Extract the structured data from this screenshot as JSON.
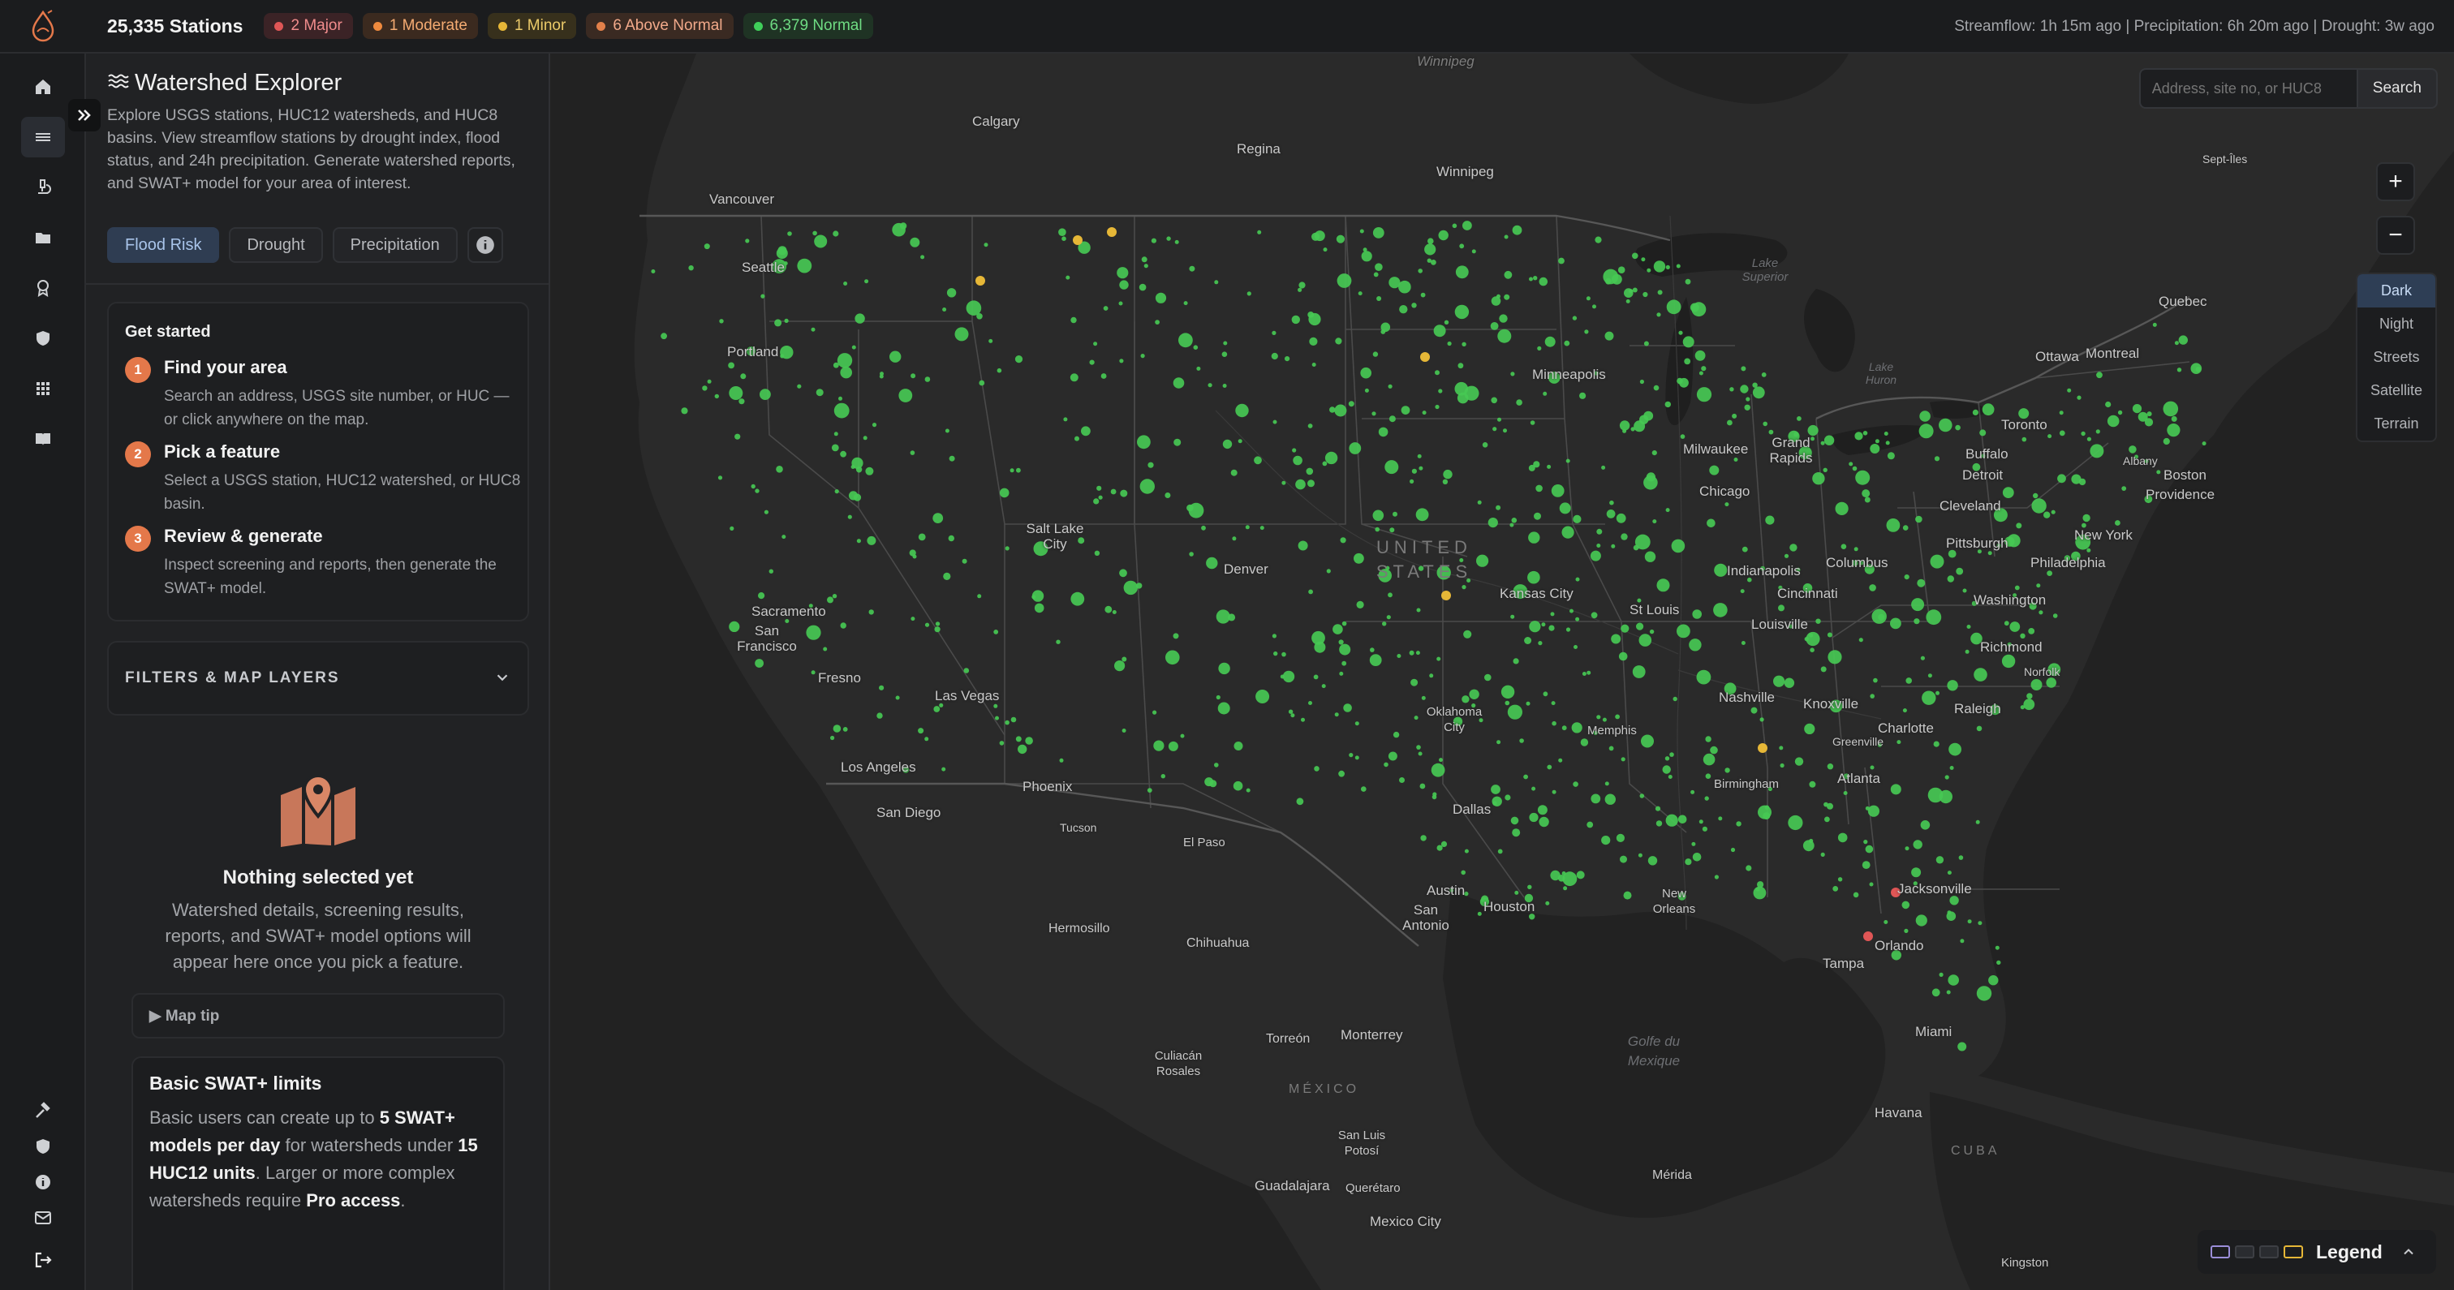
{
  "topbar": {
    "stations": "25,335 Stations",
    "badges": [
      {
        "label": "2 Major",
        "color": "#e05656",
        "bg": "#3b2326",
        "text": "#f08c8c"
      },
      {
        "label": "1 Moderate",
        "color": "#ef8a3e",
        "bg": "#3b2a1f",
        "text": "#f4ab72"
      },
      {
        "label": "1 Minor",
        "color": "#e6b737",
        "bg": "#37301c",
        "text": "#eccb6a"
      },
      {
        "label": "6 Above Normal",
        "color": "#e3804a",
        "bg": "#3a2a22",
        "text": "#f1a98a"
      },
      {
        "label": "6,379 Normal",
        "color": "#3fcf5a",
        "bg": "#1f3324",
        "text": "#6fdc83"
      }
    ],
    "status": "Streamflow: 1h 15m ago | Precipitation: 6h 20m ago | Drought: 3w ago"
  },
  "rail": {
    "top_icons": [
      "home-icon",
      "layers-icon",
      "microscope-icon",
      "folder-icon",
      "award-icon",
      "shield-check-icon",
      "grid-icon",
      "book-icon"
    ],
    "bottom_icons": [
      "hammer-icon",
      "shield-icon",
      "info-icon",
      "mail-icon",
      "logout-icon"
    ]
  },
  "panel": {
    "title": "Watershed Explorer",
    "description": "Explore USGS stations, HUC12 watersheds, and HUC8 basins. View streamflow stations by drought index, flood status, and 24h precipitation. Generate watershed reports, and SWAT+ model for your area of interest.",
    "tabs": [
      "Flood Risk",
      "Drought",
      "Precipitation"
    ],
    "get_started": {
      "title": "Get started",
      "steps": [
        {
          "num": "1",
          "title": "Find your area",
          "desc": "Search an address, USGS site number, or HUC — or click anywhere on the map."
        },
        {
          "num": "2",
          "title": "Pick a feature",
          "desc": "Select a USGS station, HUC12 watershed, or HUC8 basin."
        },
        {
          "num": "3",
          "title": "Review & generate",
          "desc": "Inspect screening and reports, then generate the SWAT+ model."
        }
      ]
    },
    "filters_label": "FILTERS & MAP LAYERS",
    "empty": {
      "title": "Nothing selected yet",
      "desc": "Watershed details, screening results, reports, and SWAT+ model options will appear here once you pick a feature."
    },
    "map_tip": "▶ Map tip",
    "limits": {
      "title": "Basic SWAT+ limits",
      "p1": "Basic users can create up to ",
      "b1": "5 SWAT+ models per day",
      "p2": " for watersheds under ",
      "b2": "15 HUC12 units",
      "p3": ". Larger or more complex watersheds require ",
      "b3": "Pro access",
      "p4": "."
    }
  },
  "map": {
    "search_placeholder": "Address, site no, or HUC8",
    "search_label": "Search",
    "zoom_in": "+",
    "zoom_out": "−",
    "styles": [
      "Dark",
      "Night",
      "Streets",
      "Satellite",
      "Terrain"
    ],
    "active_style": "Dark",
    "legend_label": "Legend",
    "cities": [
      "Winnipeg",
      "Calgary",
      "Regina",
      "Winnipeg",
      "Vancouver",
      "Seattle",
      "Portland",
      "Minneapolis",
      "Milwaukee",
      "Grand Rapids",
      "Detroit",
      "Toronto",
      "Ottawa",
      "Montreal",
      "Quebec",
      "Buffalo",
      "Albany",
      "Boston",
      "Providence",
      "Cleveland",
      "Chicago",
      "Pittsburgh",
      "New York",
      "Philadelphia",
      "Washington",
      "Richmond",
      "Norfolk",
      "Raleigh",
      "Charlotte",
      "Greenville",
      "Knoxville",
      "Nashville",
      "Louisville",
      "Cincinnati",
      "Columbus",
      "Indianapolis",
      "St Louis",
      "Kansas City",
      "Denver",
      "Salt Lake City",
      "Sacramento",
      "San Francisco",
      "Fresno",
      "Las Vegas",
      "Los Angeles",
      "San Diego",
      "Phoenix",
      "Tucson",
      "El Paso",
      "Oklahoma City",
      "Dallas",
      "Memphis",
      "Birmingham",
      "Atlanta",
      "Jacksonville",
      "Orlando",
      "Tampa",
      "Miami",
      "New Orleans",
      "Houston",
      "Austin",
      "San Antonio",
      "Hermosillo",
      "Chihuahua",
      "Torreón",
      "Monterrey",
      "Culiacán Rosales",
      "San Luis Potosí",
      "Guadalajara",
      "Querétaro",
      "Mexico City",
      "Mérida",
      "Havana",
      "Kingston",
      "Sept-Îles"
    ],
    "country_labels": [
      "UNITED STATES",
      "MÉXICO",
      "CUBA"
    ],
    "water_labels": [
      "Lake Superior",
      "Lake Huron",
      "Golfe du Mexique"
    ]
  }
}
